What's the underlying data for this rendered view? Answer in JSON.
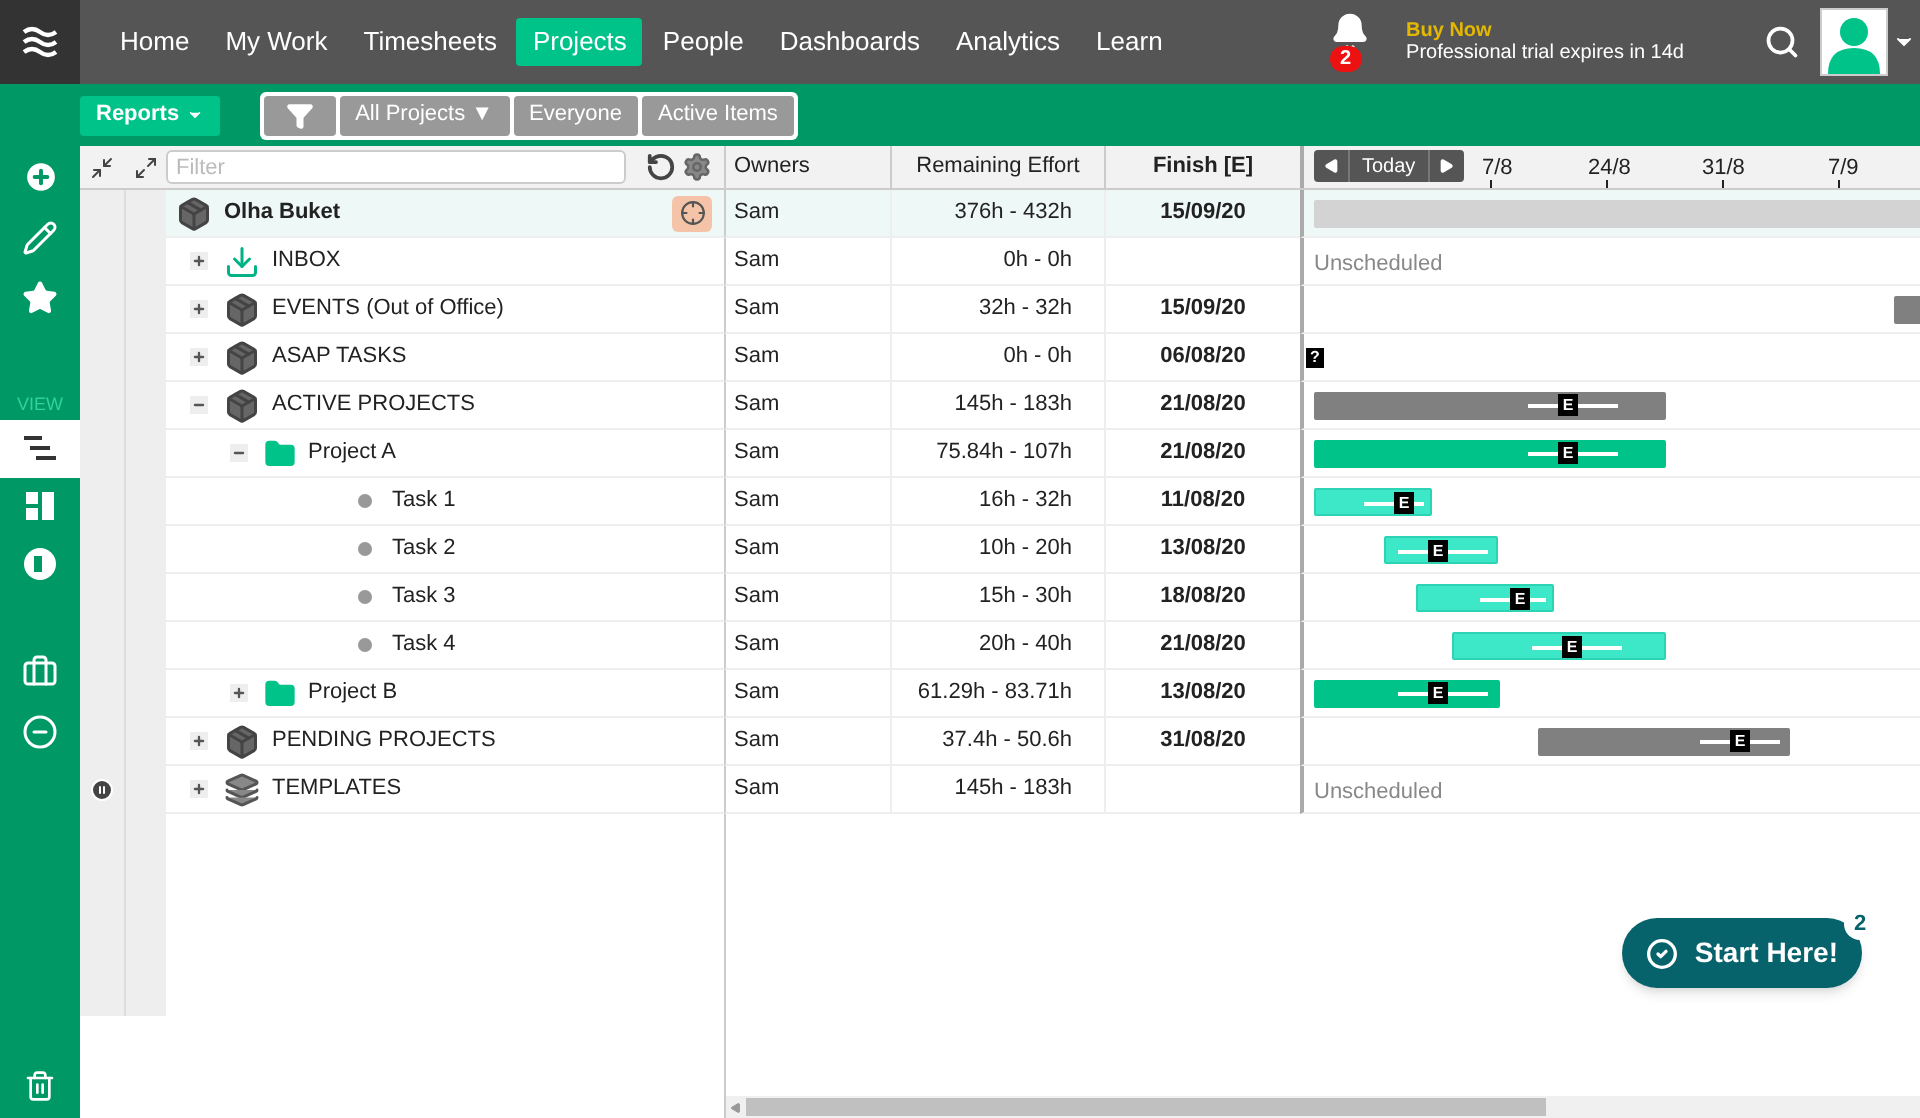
{
  "nav": {
    "items": [
      {
        "label": "Home",
        "selected": false
      },
      {
        "label": "My Work",
        "selected": false
      },
      {
        "label": "Timesheets",
        "selected": false
      },
      {
        "label": "Projects",
        "selected": true
      },
      {
        "label": "People",
        "selected": false
      },
      {
        "label": "Dashboards",
        "selected": false
      },
      {
        "label": "Analytics",
        "selected": false
      },
      {
        "label": "Learn",
        "selected": false
      }
    ]
  },
  "notifications": {
    "count": "2"
  },
  "trial": {
    "cta": "Buy Now",
    "message": "Professional trial expires in 14d"
  },
  "toolbar": {
    "reports": "Reports",
    "filters": [
      "All Projects ▼",
      "Everyone",
      "Active Items"
    ]
  },
  "sidebar": {
    "view_label": "VIEW",
    "view_items": [
      {
        "kind": "gantt",
        "selected": true
      },
      {
        "kind": "board",
        "selected": false
      },
      {
        "kind": "baseline",
        "selected": false
      }
    ]
  },
  "grid": {
    "filter": {
      "placeholder": "Filter"
    },
    "columns": [
      "Owners",
      "Remaining Effort",
      "Finish [E]"
    ],
    "rows": [
      {
        "name": "Olha Buket",
        "kind": "box",
        "owner": "Sam",
        "effort": "376h - 432h",
        "finish": "15/09/20",
        "bar": {
          "kind": "summary"
        },
        "children": [
          {
            "name": "INBOX",
            "kind": "inbox",
            "expanded": false,
            "owner": "Sam",
            "effort": "0h - 0h",
            "bar": {
              "kind": "unscheduled",
              "note": "Unscheduled"
            }
          },
          {
            "name": "EVENTS (Out of Office)",
            "kind": "box",
            "expanded": false,
            "owner": "Sam",
            "effort": "32h - 32h",
            "finish": "15/09/20",
            "bar": {
              "kind": "gray"
            }
          },
          {
            "name": "ASAP TASKS",
            "kind": "box",
            "expanded": false,
            "owner": "Sam",
            "effort": "0h - 0h",
            "finish": "06/08/20",
            "bar": {
              "kind": "unknown",
              "mark": "?"
            }
          },
          {
            "name": "ACTIVE PROJECTS",
            "kind": "box",
            "expanded": true,
            "owner": "Sam",
            "effort": "145h - 183h",
            "finish": "21/08/20",
            "bar": {
              "kind": "gray",
              "mark": "E"
            },
            "children": [
              {
                "name": "Project A",
                "kind": "folder",
                "expanded": true,
                "owner": "Sam",
                "effort": "75.84h - 107h",
                "finish": "21/08/20",
                "bar": {
                  "kind": "green",
                  "mark": "E"
                },
                "children": [
                  {
                    "name": "Task 1",
                    "kind": "task",
                    "owner": "Sam",
                    "effort": "16h - 32h",
                    "finish": "11/08/20",
                    "bar": {
                      "kind": "teal",
                      "mark": "E"
                    }
                  },
                  {
                    "name": "Task 2",
                    "kind": "task",
                    "owner": "Sam",
                    "effort": "10h - 20h",
                    "finish": "13/08/20",
                    "bar": {
                      "kind": "teal",
                      "mark": "E"
                    }
                  },
                  {
                    "name": "Task 3",
                    "kind": "task",
                    "owner": "Sam",
                    "effort": "15h - 30h",
                    "finish": "18/08/20",
                    "bar": {
                      "kind": "teal",
                      "mark": "E"
                    }
                  },
                  {
                    "name": "Task 4",
                    "kind": "task",
                    "owner": "Sam",
                    "effort": "20h - 40h",
                    "finish": "21/08/20",
                    "bar": {
                      "kind": "teal",
                      "mark": "E"
                    }
                  }
                ]
              },
              {
                "name": "Project B",
                "kind": "folder",
                "expanded": false,
                "owner": "Sam",
                "effort": "61.29h - 83.71h",
                "finish": "13/08/20",
                "bar": {
                  "kind": "green",
                  "mark": "E"
                }
              }
            ]
          },
          {
            "name": "PENDING PROJECTS",
            "kind": "box",
            "expanded": false,
            "owner": "Sam",
            "effort": "37.4h - 50.6h",
            "finish": "31/08/20",
            "bar": {
              "kind": "gray",
              "mark": "E"
            }
          },
          {
            "name": "TEMPLATES",
            "kind": "layers",
            "expanded": false,
            "owner": "Sam",
            "effort": "145h - 183h",
            "bar": {
              "kind": "unscheduled",
              "note": "Unscheduled"
            }
          }
        ]
      }
    ]
  },
  "timeline": {
    "today": "Today",
    "dates": [
      "7/8",
      "24/8",
      "31/8",
      "7/9"
    ]
  },
  "start_here": {
    "label": "Start Here!",
    "badge": "2"
  }
}
